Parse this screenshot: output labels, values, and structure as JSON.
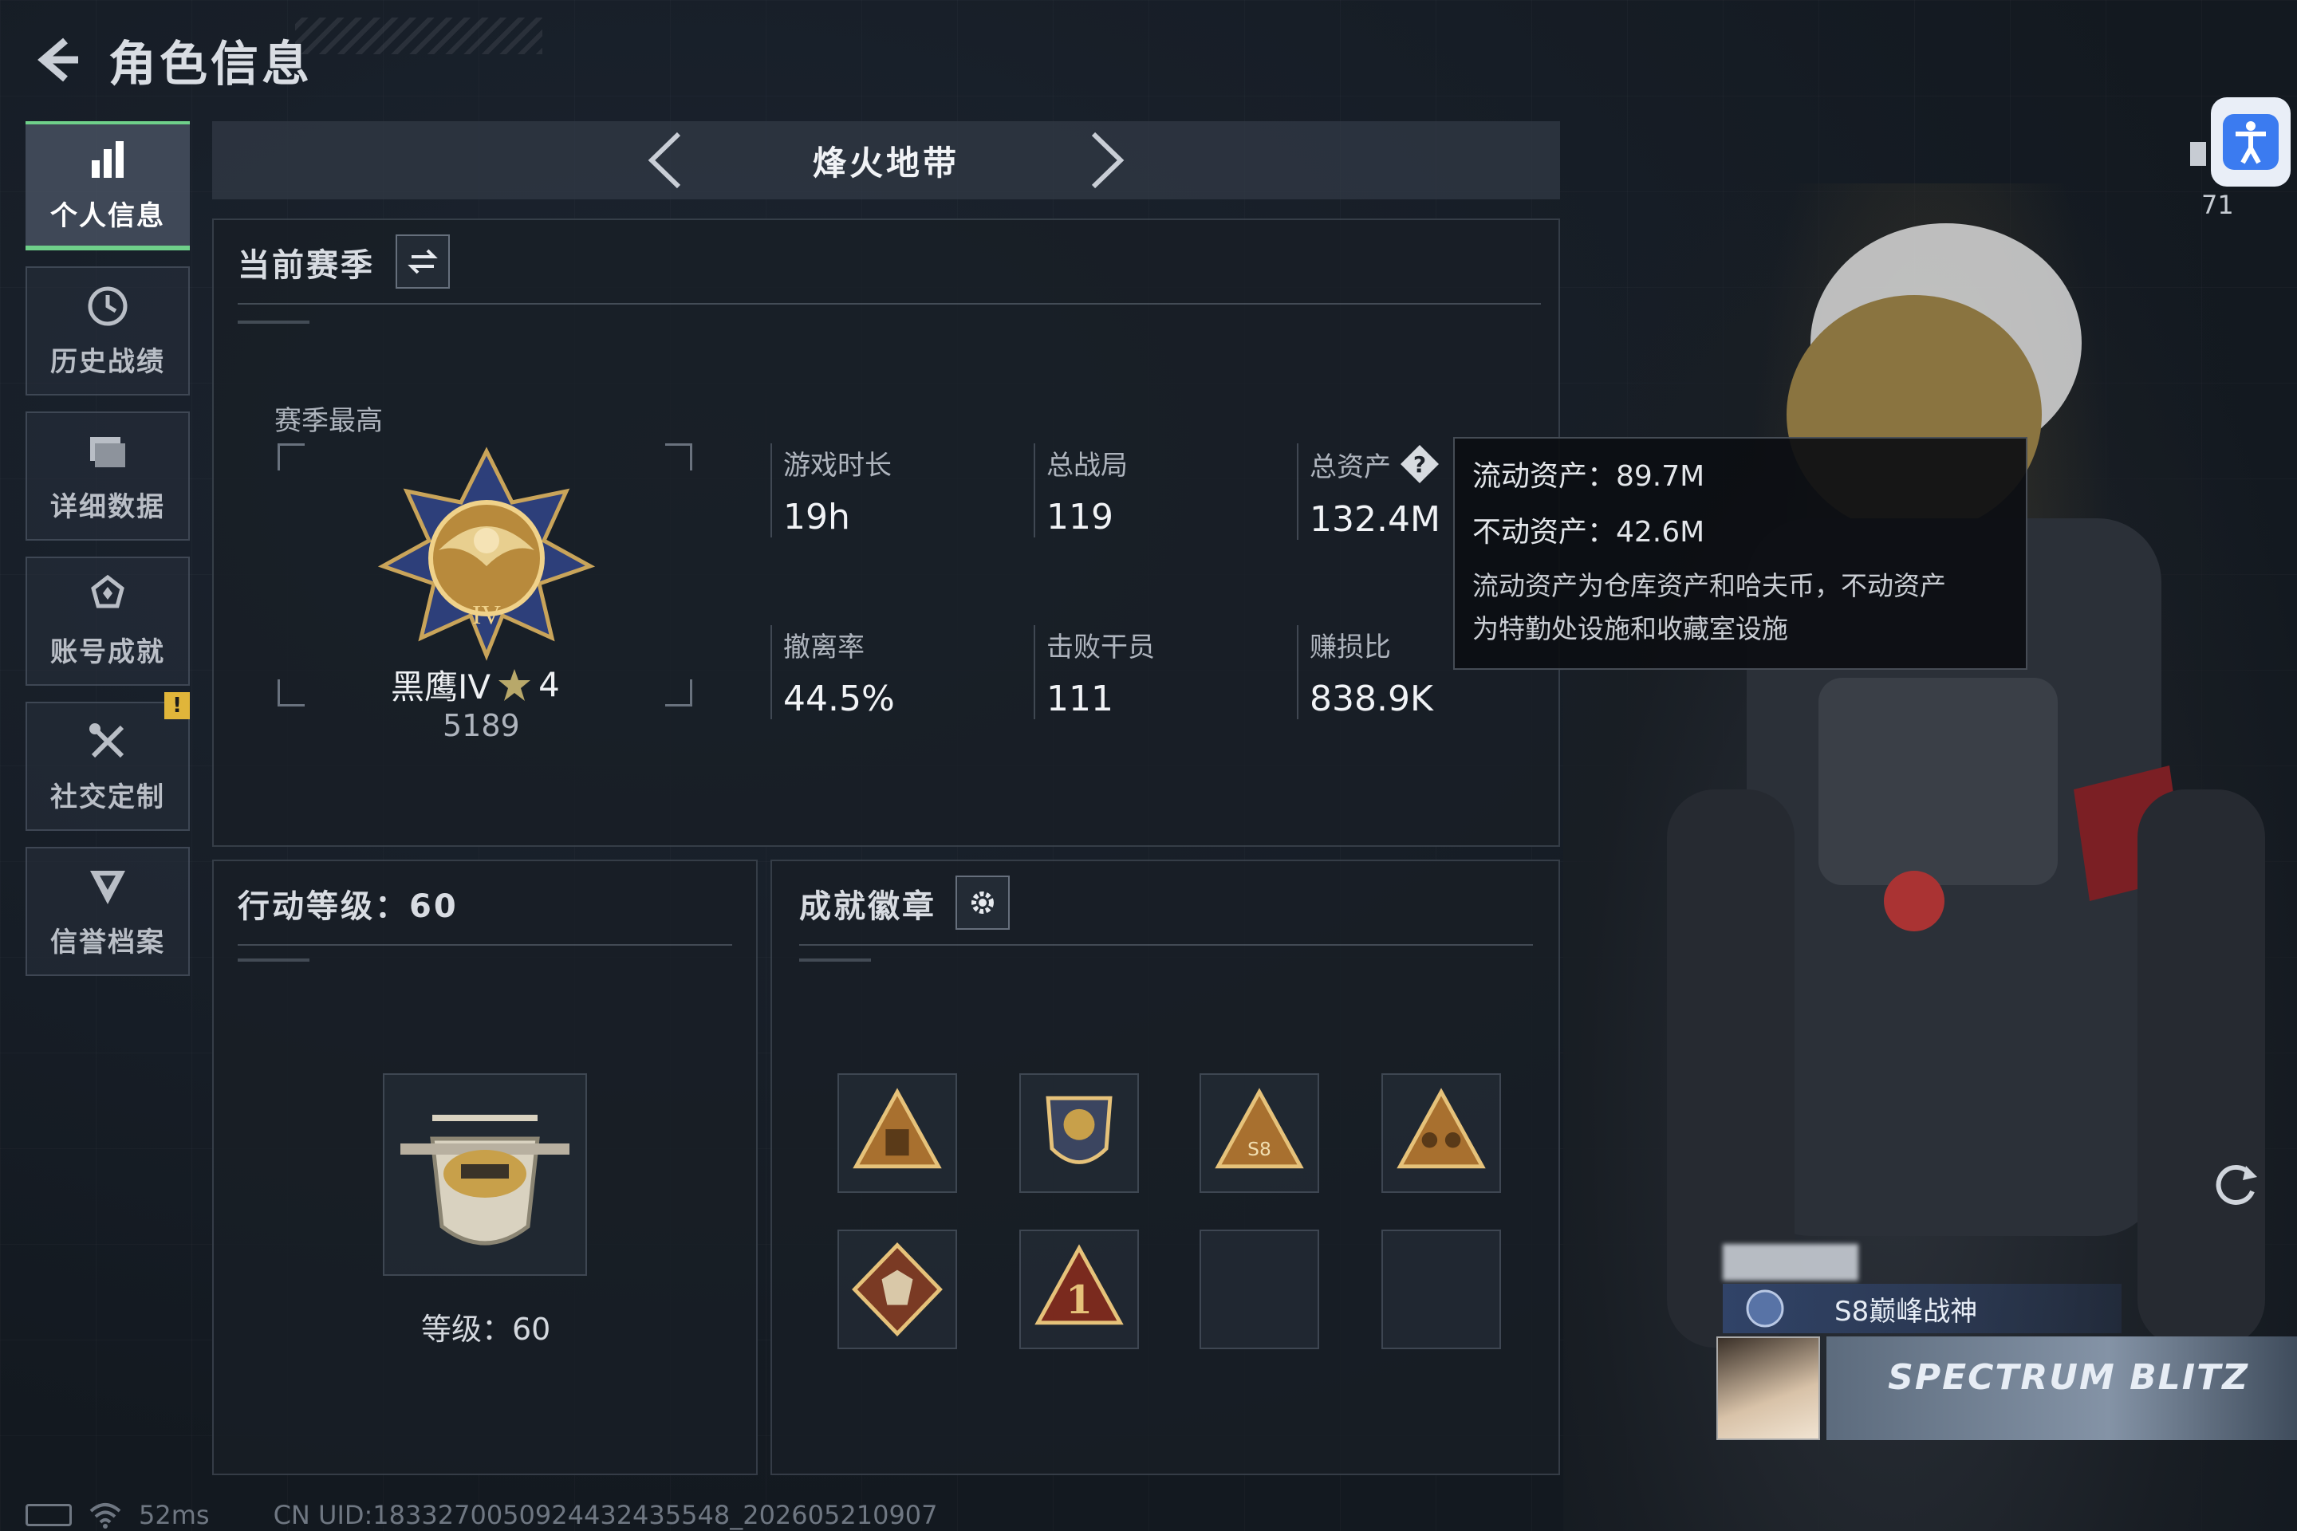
{
  "header": {
    "title": "角色信息"
  },
  "sidebar": {
    "items": [
      {
        "label": "个人信息",
        "icon": "bar-chart-icon",
        "active": true
      },
      {
        "label": "历史战绩",
        "icon": "history-icon",
        "active": false
      },
      {
        "label": "详细数据",
        "icon": "folder-icon",
        "active": false
      },
      {
        "label": "账号成就",
        "icon": "achievement-icon",
        "active": false
      },
      {
        "label": "社交定制",
        "icon": "tools-icon",
        "active": false,
        "badge": "!"
      },
      {
        "label": "信誉档案",
        "icon": "shield-icon",
        "active": false
      }
    ]
  },
  "map_selector": {
    "name": "烽火地带"
  },
  "season": {
    "title": "当前赛季",
    "best_label": "赛季最高",
    "rank_name": "黑鹰IV",
    "rank_stars": "4",
    "rank_score": "5189",
    "stats": [
      {
        "label": "游戏时长",
        "value": "19h"
      },
      {
        "label": "总战局",
        "value": "119"
      },
      {
        "label": "总资产",
        "value": "132.4M"
      },
      {
        "label": "撤离率",
        "value": "44.5%"
      },
      {
        "label": "击败干员",
        "value": "111"
      },
      {
        "label": "赚损比",
        "value": "838.9K"
      }
    ]
  },
  "tooltip": {
    "liquid": "流动资产：89.7M",
    "fixed": "不动资产：42.6M",
    "desc_line1": "流动资产为仓库资产和哈夫币，不动资产",
    "desc_line2": "为特勤处设施和收藏室设施"
  },
  "action_level": {
    "title": "行动等级：60",
    "level_text": "等级：60"
  },
  "badges": {
    "title": "成就徽章",
    "items": [
      "triangle-badge",
      "shield-wings-badge",
      "s8-triangle-badge",
      "soldiers-triangle-badge",
      "wolf-diamond-badge",
      "rank-one-badge",
      "empty",
      "empty"
    ]
  },
  "character": {
    "signal_count": "71",
    "player_title": "S8巅峰战神",
    "banner_logo": "SPECTRUM BLITZ"
  },
  "footer": {
    "ping": "52ms",
    "uid": "CN UID:1833270050924432435548_202605210907"
  },
  "colors": {
    "active_accent": "#6fd08a",
    "warning": "#e0b53a",
    "accessibility": "#3b7bf0"
  }
}
